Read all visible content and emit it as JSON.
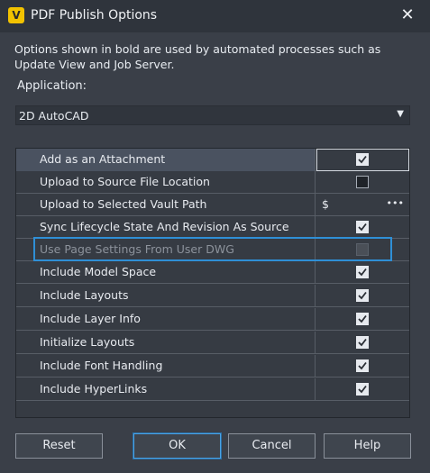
{
  "window": {
    "title": "PDF Publish Options",
    "app_icon_letter": "V"
  },
  "description": "Options shown in bold are used by automated processes such as Update View and Job Server.",
  "application": {
    "label": "Application:",
    "selected": "2D AutoCAD"
  },
  "options": [
    {
      "label": "Add as an Attachment",
      "type": "checkbox",
      "checked": true,
      "selected": true
    },
    {
      "label": "Upload to Source File Location",
      "type": "checkbox",
      "checked": false
    },
    {
      "label": "Upload to Selected Vault Path",
      "type": "path",
      "value": "$"
    },
    {
      "label": "Sync Lifecycle State And Revision As Source",
      "type": "checkbox",
      "checked": true
    },
    {
      "label": "Use Page Settings From User DWG",
      "type": "checkbox",
      "checked": false,
      "disabled": true
    },
    {
      "label": "Include Model Space",
      "type": "checkbox",
      "checked": true
    },
    {
      "label": "Include Layouts",
      "type": "checkbox",
      "checked": true
    },
    {
      "label": "Include Layer Info",
      "type": "checkbox",
      "checked": true
    },
    {
      "label": "Initialize Layouts",
      "type": "checkbox",
      "checked": true
    },
    {
      "label": "Include Font Handling",
      "type": "checkbox",
      "checked": true
    },
    {
      "label": "Include HyperLinks",
      "type": "checkbox",
      "checked": true
    }
  ],
  "buttons": {
    "reset": "Reset",
    "ok": "OK",
    "cancel": "Cancel",
    "help": "Help"
  },
  "colors": {
    "highlight": "#2f8fd6",
    "app_icon": "#f2c200"
  }
}
